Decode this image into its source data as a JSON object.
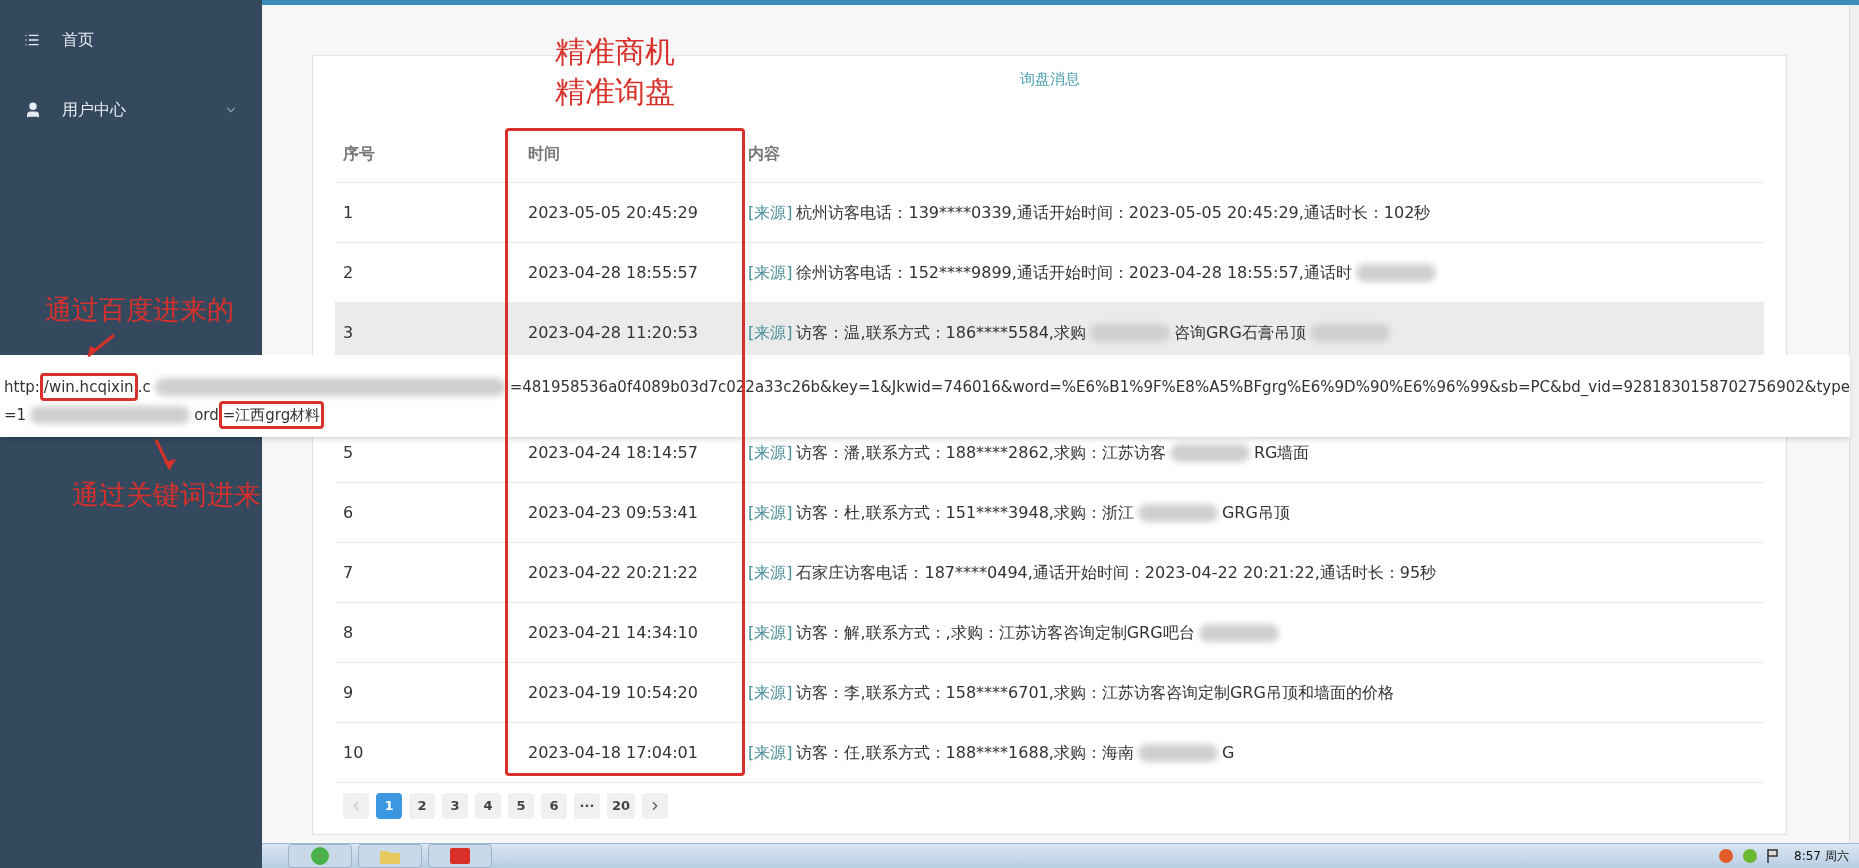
{
  "sidebar": {
    "items": [
      {
        "label": "首页",
        "kind": "list",
        "expanded": false
      },
      {
        "label": "用户中心",
        "kind": "user",
        "expanded": false
      }
    ]
  },
  "card": {
    "title": "询盘消息"
  },
  "table": {
    "columns": [
      "序号",
      "时间",
      "内容"
    ],
    "rows": [
      {
        "index": "1",
        "time": "2023-05-05 20:45:29",
        "source": "[来源]",
        "highlighted": false,
        "parts": [
          {
            "kind": "text",
            "text": "杭州访客电话：139****0339,通话开始时间：2023-05-05 20:45:29,通话时长：102秒"
          }
        ]
      },
      {
        "index": "2",
        "time": "2023-04-28 18:55:57",
        "source": "[来源]",
        "highlighted": false,
        "parts": [
          {
            "kind": "text",
            "text": "徐州访客电话：152****9899,通话开始时间：2023-04-28 18:55:57,通话时"
          },
          {
            "kind": "blur"
          }
        ]
      },
      {
        "index": "3",
        "time": "2023-04-28 11:20:53",
        "source": "[来源]",
        "highlighted": true,
        "gap_below": true,
        "parts": [
          {
            "kind": "text",
            "text": "访客：温,联系方式：186****5584,求购"
          },
          {
            "kind": "blur"
          },
          {
            "kind": "text",
            "text": "咨询GRG石膏吊顶"
          },
          {
            "kind": "blur"
          }
        ]
      },
      {
        "index": "5",
        "time": "2023-04-24 18:14:57",
        "source": "[来源]",
        "highlighted": false,
        "parts": [
          {
            "kind": "text",
            "text": "访客：潘,联系方式：188****2862,求购：江苏访客"
          },
          {
            "kind": "blur"
          },
          {
            "kind": "text",
            "text": "RG墙面"
          }
        ]
      },
      {
        "index": "6",
        "time": "2023-04-23 09:53:41",
        "source": "[来源]",
        "highlighted": false,
        "parts": [
          {
            "kind": "text",
            "text": "访客：杜,联系方式：151****3948,求购：浙江"
          },
          {
            "kind": "blur"
          },
          {
            "kind": "text",
            "text": "GRG吊顶"
          }
        ]
      },
      {
        "index": "7",
        "time": "2023-04-22 20:21:22",
        "source": "[来源]",
        "highlighted": false,
        "parts": [
          {
            "kind": "text",
            "text": "石家庄访客电话：187****0494,通话开始时间：2023-04-22 20:21:22,通话时长：95秒"
          }
        ]
      },
      {
        "index": "8",
        "time": "2023-04-21 14:34:10",
        "source": "[来源]",
        "highlighted": false,
        "parts": [
          {
            "kind": "text",
            "text": "访客：解,联系方式：,求购：江苏访客咨询定制GRG吧台"
          },
          {
            "kind": "blur"
          }
        ]
      },
      {
        "index": "9",
        "time": "2023-04-19 10:54:20",
        "source": "[来源]",
        "highlighted": false,
        "parts": [
          {
            "kind": "text",
            "text": "访客：李,联系方式：158****6701,求购：江苏访客咨询定制GRG吊顶和墙面的价格"
          }
        ]
      },
      {
        "index": "10",
        "time": "2023-04-18 17:04:01",
        "source": "[来源]",
        "highlighted": false,
        "parts": [
          {
            "kind": "text",
            "text": "访客：任,联系方式：188****1688,求购：海南"
          },
          {
            "kind": "blur"
          },
          {
            "kind": "text",
            "text": "G"
          }
        ]
      }
    ]
  },
  "pagination": {
    "prev_disabled": true,
    "pages": [
      {
        "label": "1",
        "selected": true
      },
      {
        "label": "2",
        "selected": false
      },
      {
        "label": "3",
        "selected": false
      },
      {
        "label": "4",
        "selected": false
      },
      {
        "label": "5",
        "selected": false
      },
      {
        "label": "6",
        "selected": false
      },
      {
        "label": "···",
        "selected": false
      },
      {
        "label": "20",
        "selected": false
      }
    ]
  },
  "url_popup": {
    "lines": [
      [
        {
          "kind": "text",
          "text": "http:"
        },
        {
          "kind": "marked",
          "text": "/win.hcqixin"
        },
        {
          "kind": "text",
          "text": ".c"
        },
        {
          "kind": "blur"
        },
        {
          "kind": "text",
          "text": "=481958536a0f4089b03d7c022a33c26b&key=1&Jkwid=746016&word=%E6%B1%9F%E8%A5%BFgrg%E6%9D%90%E6%96%99&sb=PC&bd_vid=9281830158702756902&type"
        }
      ],
      [
        {
          "kind": "text",
          "text": "=1"
        },
        {
          "kind": "blur"
        },
        {
          "kind": "text",
          "text": "ord"
        },
        {
          "kind": "marked",
          "text": "=江西grg材料"
        }
      ]
    ]
  },
  "annotations": {
    "column_note": [
      "精准商机",
      "精准询盘"
    ],
    "baidu_note": "通过百度进来的",
    "keyword_note": "通过关键词进来"
  },
  "taskbar": {
    "time": "8:57",
    "day": "周六"
  }
}
